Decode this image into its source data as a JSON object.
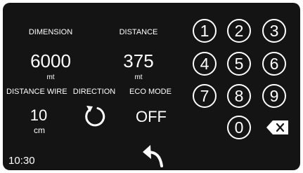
{
  "left_panel": {
    "dimension": {
      "label": "DIMENSION",
      "value": "6000",
      "unit": "mt"
    },
    "distance": {
      "label": "DISTANCE",
      "value": "375",
      "unit": "mt"
    },
    "distance_wire": {
      "label": "DISTANCE WIRE",
      "value": "10",
      "unit": "cm"
    },
    "direction": {
      "label": "DIRECTION",
      "icon": "rotate-clockwise-icon"
    },
    "eco_mode": {
      "label": "ECO MODE",
      "value": "OFF"
    },
    "clock": "10:30",
    "back_icon": "back-arrow-icon"
  },
  "keypad": {
    "keys": [
      "1",
      "2",
      "3",
      "4",
      "5",
      "6",
      "7",
      "8",
      "9",
      "0"
    ],
    "backspace_icon": "backspace-icon"
  },
  "colors": {
    "screen_bg": "#141414",
    "border": "#ffffff",
    "text": "#ffffff"
  }
}
